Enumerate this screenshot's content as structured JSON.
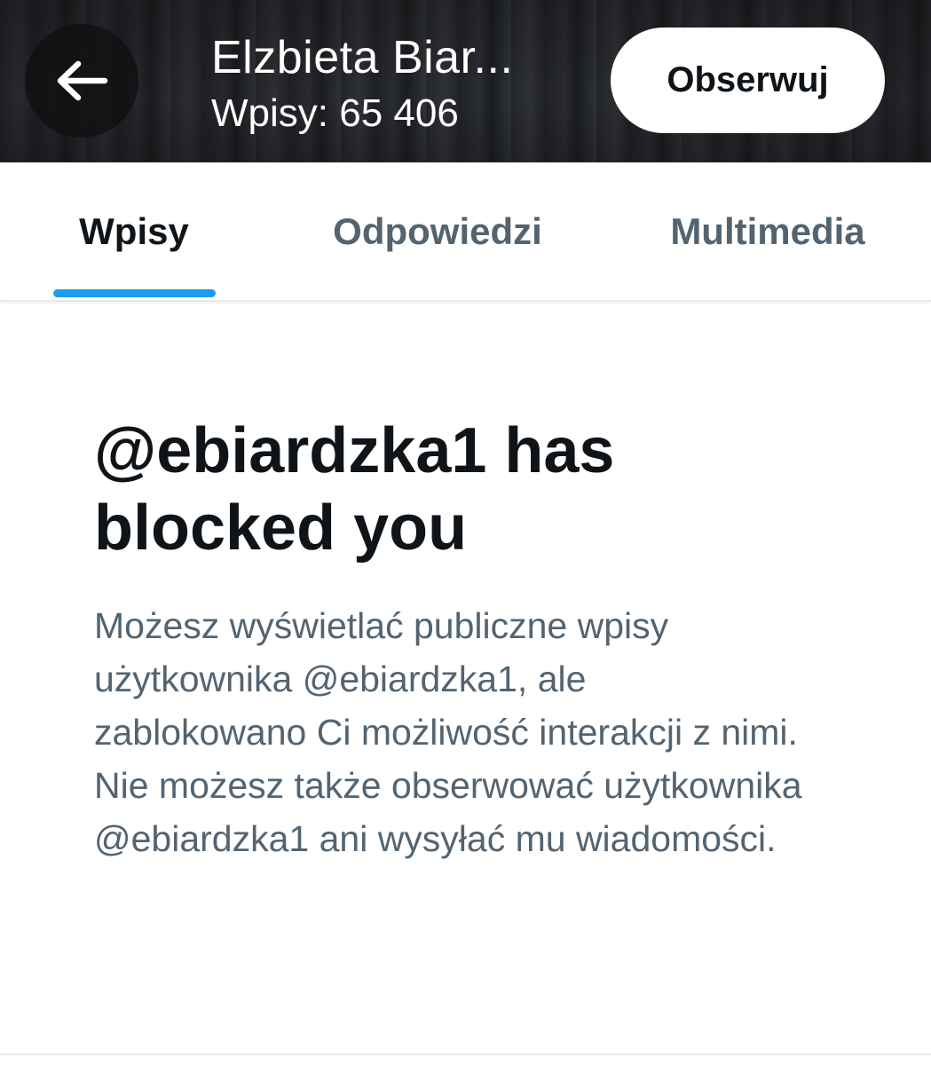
{
  "header": {
    "name": "Elzbieta Biar...",
    "posts_count": "Wpisy: 65 406",
    "follow_label": "Obserwuj",
    "back_icon": "arrow-left-icon"
  },
  "tabs": [
    {
      "label": "Wpisy",
      "active": true
    },
    {
      "label": "Odpowiedzi",
      "active": false
    },
    {
      "label": "Multimedia",
      "active": false
    }
  ],
  "blocked": {
    "title": "@ebiardzka1 has blocked you",
    "description": "Możesz wyświetlać publiczne wpisy użytkownika @ebiardzka1, ale zablokowano Ci możliwość interakcji z nimi. Nie możesz także obserwować użytkownika @ebiardzka1 ani wysyłać mu wiadomości."
  },
  "colors": {
    "accent": "#1d9bf0",
    "text_primary": "#0f1419",
    "text_secondary": "#536471"
  }
}
